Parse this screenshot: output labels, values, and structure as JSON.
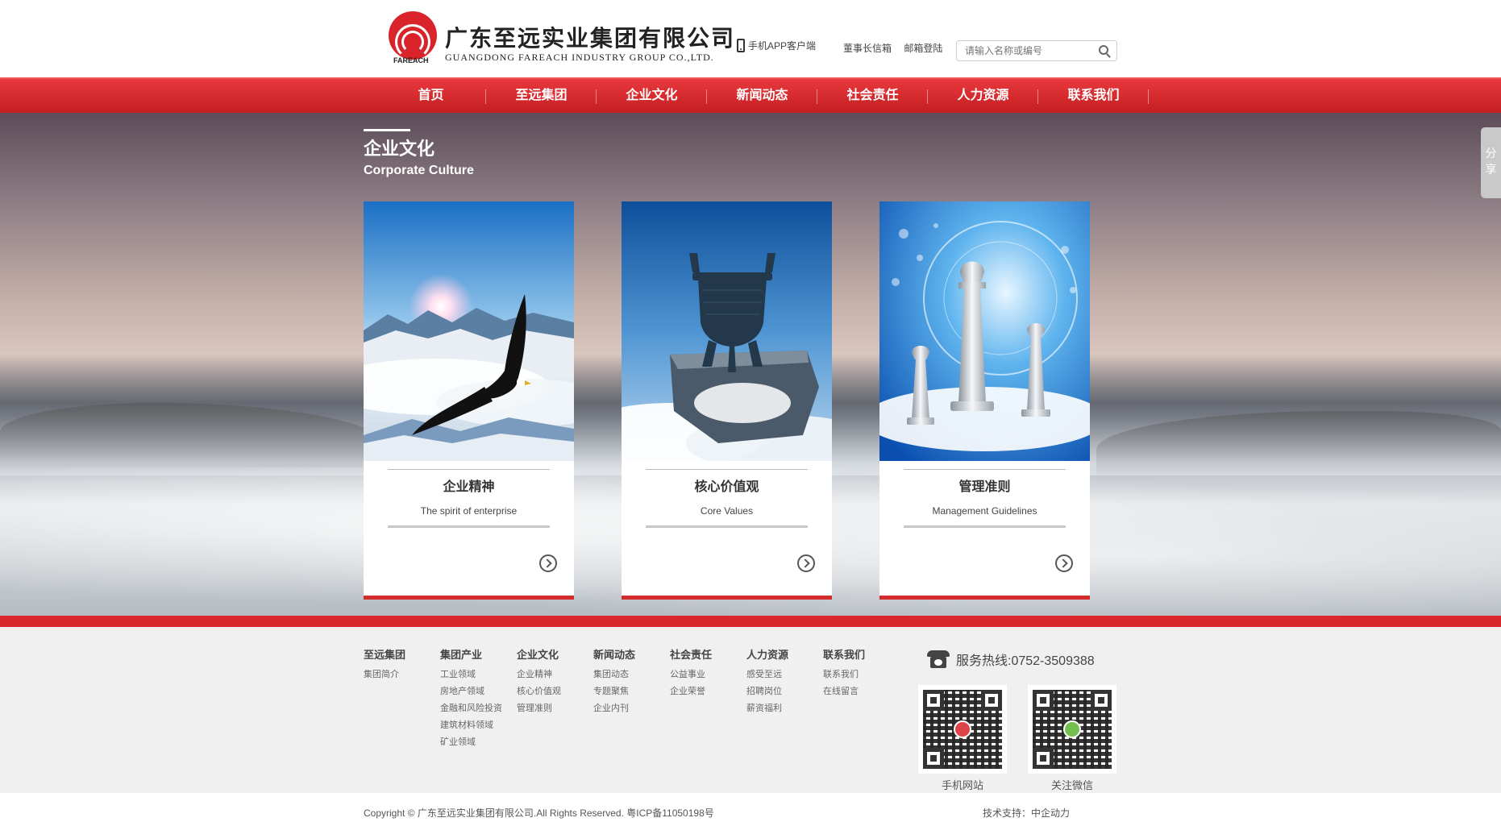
{
  "header": {
    "logo_text": "FAREACH",
    "company_cn": "广东至远实业集团有限公司",
    "company_en": "GUANGDONG FAREACH INDUSTRY GROUP CO.,LTD.",
    "app_link": "手机APP客户端",
    "chairman_mailbox": "董事长信箱",
    "mail_login": "邮箱登陆",
    "search_placeholder": "请输入名称或编号"
  },
  "nav": {
    "items": [
      "首页",
      "至远集团",
      "企业文化",
      "新闻动态",
      "社会责任",
      "人力资源",
      "联系我们"
    ]
  },
  "section": {
    "title_cn": "企业文化",
    "title_en": "Corporate Culture"
  },
  "cards": [
    {
      "title": "企业精神",
      "subtitle": "The spirit of enterprise",
      "image": "eagle-over-mountains"
    },
    {
      "title": "核心价值观",
      "subtitle": "Core Values",
      "image": "bronze-tripod-on-cliff"
    },
    {
      "title": "管理准则",
      "subtitle": "Management Guidelines",
      "image": "chess-pieces-in-clouds"
    }
  ],
  "share_label": [
    "分",
    "享"
  ],
  "footer": {
    "columns": [
      {
        "head": "至远集团",
        "items": [
          "集团简介"
        ]
      },
      {
        "head": "集团产业",
        "items": [
          "工业领域",
          "房地产领域",
          "金融和风险投资",
          "建筑材料领域",
          "矿业领域"
        ]
      },
      {
        "head": "企业文化",
        "items": [
          "企业精神",
          "核心价值观",
          "管理准则"
        ]
      },
      {
        "head": "新闻动态",
        "items": [
          "集团动态",
          "专题聚焦",
          "企业内刊"
        ]
      },
      {
        "head": "社会责任",
        "items": [
          "公益事业",
          "企业荣誉"
        ]
      },
      {
        "head": "人力资源",
        "items": [
          "感受至远",
          "招聘岗位",
          "薪资福利"
        ]
      },
      {
        "head": "联系我们",
        "items": [
          "联系我们",
          "在线留言"
        ]
      }
    ],
    "hotline": "服务热线:0752-3509388",
    "qr": [
      {
        "caption": "手机网站"
      },
      {
        "caption": "关注微信"
      }
    ],
    "copyright": "Copyright © 广东至远实业集团有限公司.All Rights Reserved. 粤ICP备11050198号",
    "tech_support": "技术支持：中企动力"
  },
  "colors": {
    "brand_red": "#d8282c",
    "footer_bg": "#f0f0f0"
  }
}
